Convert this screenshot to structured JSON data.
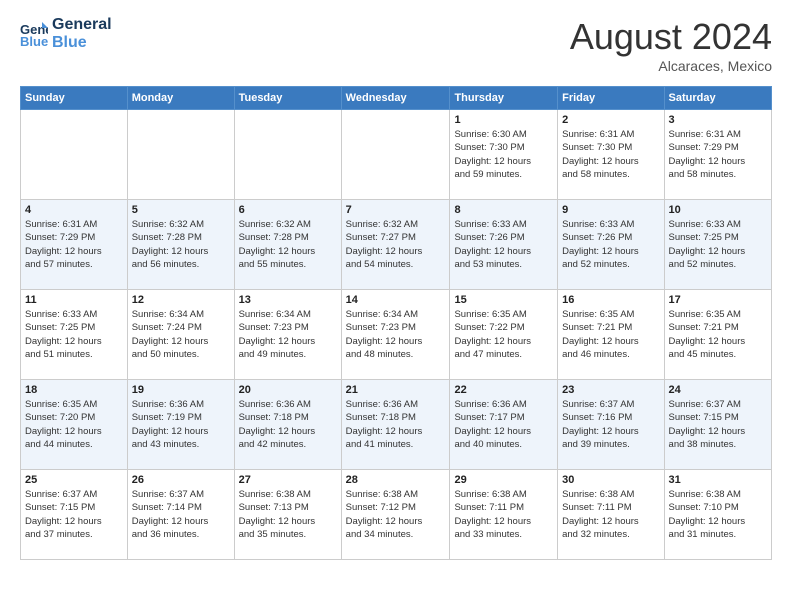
{
  "header": {
    "logo_line1": "General",
    "logo_line2": "Blue",
    "month": "August 2024",
    "location": "Alcaraces, Mexico"
  },
  "weekdays": [
    "Sunday",
    "Monday",
    "Tuesday",
    "Wednesday",
    "Thursday",
    "Friday",
    "Saturday"
  ],
  "weeks": [
    [
      {
        "day": "",
        "info": ""
      },
      {
        "day": "",
        "info": ""
      },
      {
        "day": "",
        "info": ""
      },
      {
        "day": "",
        "info": ""
      },
      {
        "day": "1",
        "info": "Sunrise: 6:30 AM\nSunset: 7:30 PM\nDaylight: 12 hours\nand 59 minutes."
      },
      {
        "day": "2",
        "info": "Sunrise: 6:31 AM\nSunset: 7:30 PM\nDaylight: 12 hours\nand 58 minutes."
      },
      {
        "day": "3",
        "info": "Sunrise: 6:31 AM\nSunset: 7:29 PM\nDaylight: 12 hours\nand 58 minutes."
      }
    ],
    [
      {
        "day": "4",
        "info": "Sunrise: 6:31 AM\nSunset: 7:29 PM\nDaylight: 12 hours\nand 57 minutes."
      },
      {
        "day": "5",
        "info": "Sunrise: 6:32 AM\nSunset: 7:28 PM\nDaylight: 12 hours\nand 56 minutes."
      },
      {
        "day": "6",
        "info": "Sunrise: 6:32 AM\nSunset: 7:28 PM\nDaylight: 12 hours\nand 55 minutes."
      },
      {
        "day": "7",
        "info": "Sunrise: 6:32 AM\nSunset: 7:27 PM\nDaylight: 12 hours\nand 54 minutes."
      },
      {
        "day": "8",
        "info": "Sunrise: 6:33 AM\nSunset: 7:26 PM\nDaylight: 12 hours\nand 53 minutes."
      },
      {
        "day": "9",
        "info": "Sunrise: 6:33 AM\nSunset: 7:26 PM\nDaylight: 12 hours\nand 52 minutes."
      },
      {
        "day": "10",
        "info": "Sunrise: 6:33 AM\nSunset: 7:25 PM\nDaylight: 12 hours\nand 52 minutes."
      }
    ],
    [
      {
        "day": "11",
        "info": "Sunrise: 6:33 AM\nSunset: 7:25 PM\nDaylight: 12 hours\nand 51 minutes."
      },
      {
        "day": "12",
        "info": "Sunrise: 6:34 AM\nSunset: 7:24 PM\nDaylight: 12 hours\nand 50 minutes."
      },
      {
        "day": "13",
        "info": "Sunrise: 6:34 AM\nSunset: 7:23 PM\nDaylight: 12 hours\nand 49 minutes."
      },
      {
        "day": "14",
        "info": "Sunrise: 6:34 AM\nSunset: 7:23 PM\nDaylight: 12 hours\nand 48 minutes."
      },
      {
        "day": "15",
        "info": "Sunrise: 6:35 AM\nSunset: 7:22 PM\nDaylight: 12 hours\nand 47 minutes."
      },
      {
        "day": "16",
        "info": "Sunrise: 6:35 AM\nSunset: 7:21 PM\nDaylight: 12 hours\nand 46 minutes."
      },
      {
        "day": "17",
        "info": "Sunrise: 6:35 AM\nSunset: 7:21 PM\nDaylight: 12 hours\nand 45 minutes."
      }
    ],
    [
      {
        "day": "18",
        "info": "Sunrise: 6:35 AM\nSunset: 7:20 PM\nDaylight: 12 hours\nand 44 minutes."
      },
      {
        "day": "19",
        "info": "Sunrise: 6:36 AM\nSunset: 7:19 PM\nDaylight: 12 hours\nand 43 minutes."
      },
      {
        "day": "20",
        "info": "Sunrise: 6:36 AM\nSunset: 7:18 PM\nDaylight: 12 hours\nand 42 minutes."
      },
      {
        "day": "21",
        "info": "Sunrise: 6:36 AM\nSunset: 7:18 PM\nDaylight: 12 hours\nand 41 minutes."
      },
      {
        "day": "22",
        "info": "Sunrise: 6:36 AM\nSunset: 7:17 PM\nDaylight: 12 hours\nand 40 minutes."
      },
      {
        "day": "23",
        "info": "Sunrise: 6:37 AM\nSunset: 7:16 PM\nDaylight: 12 hours\nand 39 minutes."
      },
      {
        "day": "24",
        "info": "Sunrise: 6:37 AM\nSunset: 7:15 PM\nDaylight: 12 hours\nand 38 minutes."
      }
    ],
    [
      {
        "day": "25",
        "info": "Sunrise: 6:37 AM\nSunset: 7:15 PM\nDaylight: 12 hours\nand 37 minutes."
      },
      {
        "day": "26",
        "info": "Sunrise: 6:37 AM\nSunset: 7:14 PM\nDaylight: 12 hours\nand 36 minutes."
      },
      {
        "day": "27",
        "info": "Sunrise: 6:38 AM\nSunset: 7:13 PM\nDaylight: 12 hours\nand 35 minutes."
      },
      {
        "day": "28",
        "info": "Sunrise: 6:38 AM\nSunset: 7:12 PM\nDaylight: 12 hours\nand 34 minutes."
      },
      {
        "day": "29",
        "info": "Sunrise: 6:38 AM\nSunset: 7:11 PM\nDaylight: 12 hours\nand 33 minutes."
      },
      {
        "day": "30",
        "info": "Sunrise: 6:38 AM\nSunset: 7:11 PM\nDaylight: 12 hours\nand 32 minutes."
      },
      {
        "day": "31",
        "info": "Sunrise: 6:38 AM\nSunset: 7:10 PM\nDaylight: 12 hours\nand 31 minutes."
      }
    ]
  ]
}
